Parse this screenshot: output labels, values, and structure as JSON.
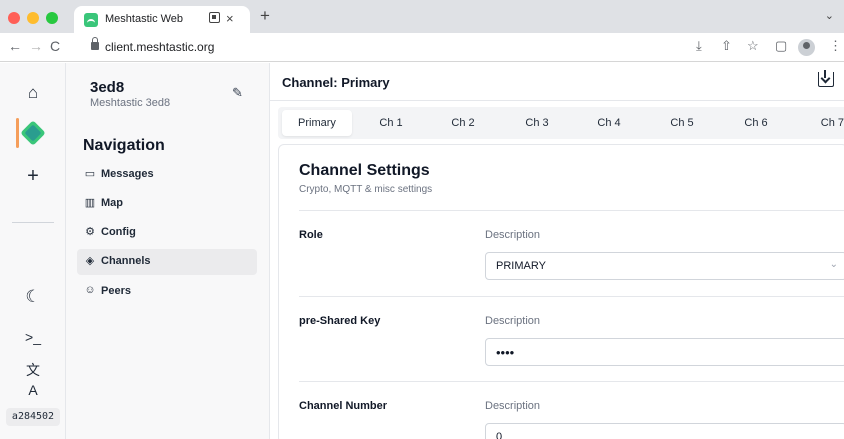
{
  "browser": {
    "tab_title": "Meshtastic Web",
    "tab_close": "×",
    "new_tab": "+",
    "tab_menu": "⌄",
    "url": "client.meshtastic.org",
    "nav_back": "←",
    "nav_forward": "→",
    "nav_reload": "C",
    "icons": [
      "install-icon",
      "share-icon",
      "bookmark-star-icon",
      "side-panel-icon",
      "profile-icon",
      "kebab-menu-icon"
    ]
  },
  "rail": {
    "icons": [
      "home-icon",
      "node-icon",
      "add-icon",
      "moon-icon",
      "terminal-icon",
      "language-icon"
    ],
    "add_glyph": "+",
    "node_id": "a284502",
    "accent": "#f59e5b"
  },
  "sidebar": {
    "node_name": "3ed8",
    "node_long_name": "Meshtastic 3ed8",
    "nav_title": "Navigation",
    "items": [
      {
        "label": "Messages",
        "icon": "message-icon",
        "glyph": "▭"
      },
      {
        "label": "Map",
        "icon": "map-icon",
        "glyph": "▥"
      },
      {
        "label": "Config",
        "icon": "gear-icon",
        "glyph": "⚙"
      },
      {
        "label": "Channels",
        "icon": "layers-icon",
        "glyph": "◈",
        "active": true
      },
      {
        "label": "Peers",
        "icon": "users-icon",
        "glyph": "☺"
      }
    ]
  },
  "main": {
    "title": "Channel: Primary",
    "tabs": [
      "Primary",
      "Ch 1",
      "Ch 2",
      "Ch 3",
      "Ch 4",
      "Ch 5",
      "Ch 6",
      "Ch 7"
    ],
    "active_tab": "Primary",
    "card": {
      "title": "Channel Settings",
      "subtitle": "Crypto, MQTT & misc settings",
      "fields": [
        {
          "label": "Role",
          "description": "Description",
          "value": "PRIMARY",
          "type": "select"
        },
        {
          "label": "pre-Shared Key",
          "description": "Description",
          "value": "••••",
          "type": "password"
        },
        {
          "label": "Channel Number",
          "description": "Description",
          "value": "0",
          "type": "number"
        }
      ]
    }
  }
}
